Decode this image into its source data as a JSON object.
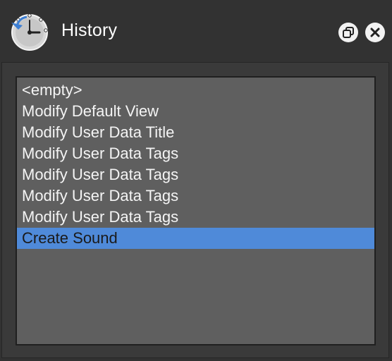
{
  "window": {
    "title": "History"
  },
  "titlebar_buttons": {
    "restore_icon": "restore-window-icon",
    "close_icon": "close-icon"
  },
  "history": {
    "selected_index": 7,
    "items": [
      "<empty>",
      "Modify Default View",
      "Modify User Data Title",
      "Modify User Data Tags",
      "Modify User Data Tags",
      "Modify User Data Tags",
      "Modify User Data Tags",
      "Create Sound"
    ]
  },
  "colors": {
    "selection": "#4f8ad9",
    "list_background": "#5f5f5f",
    "window_background": "#323232"
  }
}
